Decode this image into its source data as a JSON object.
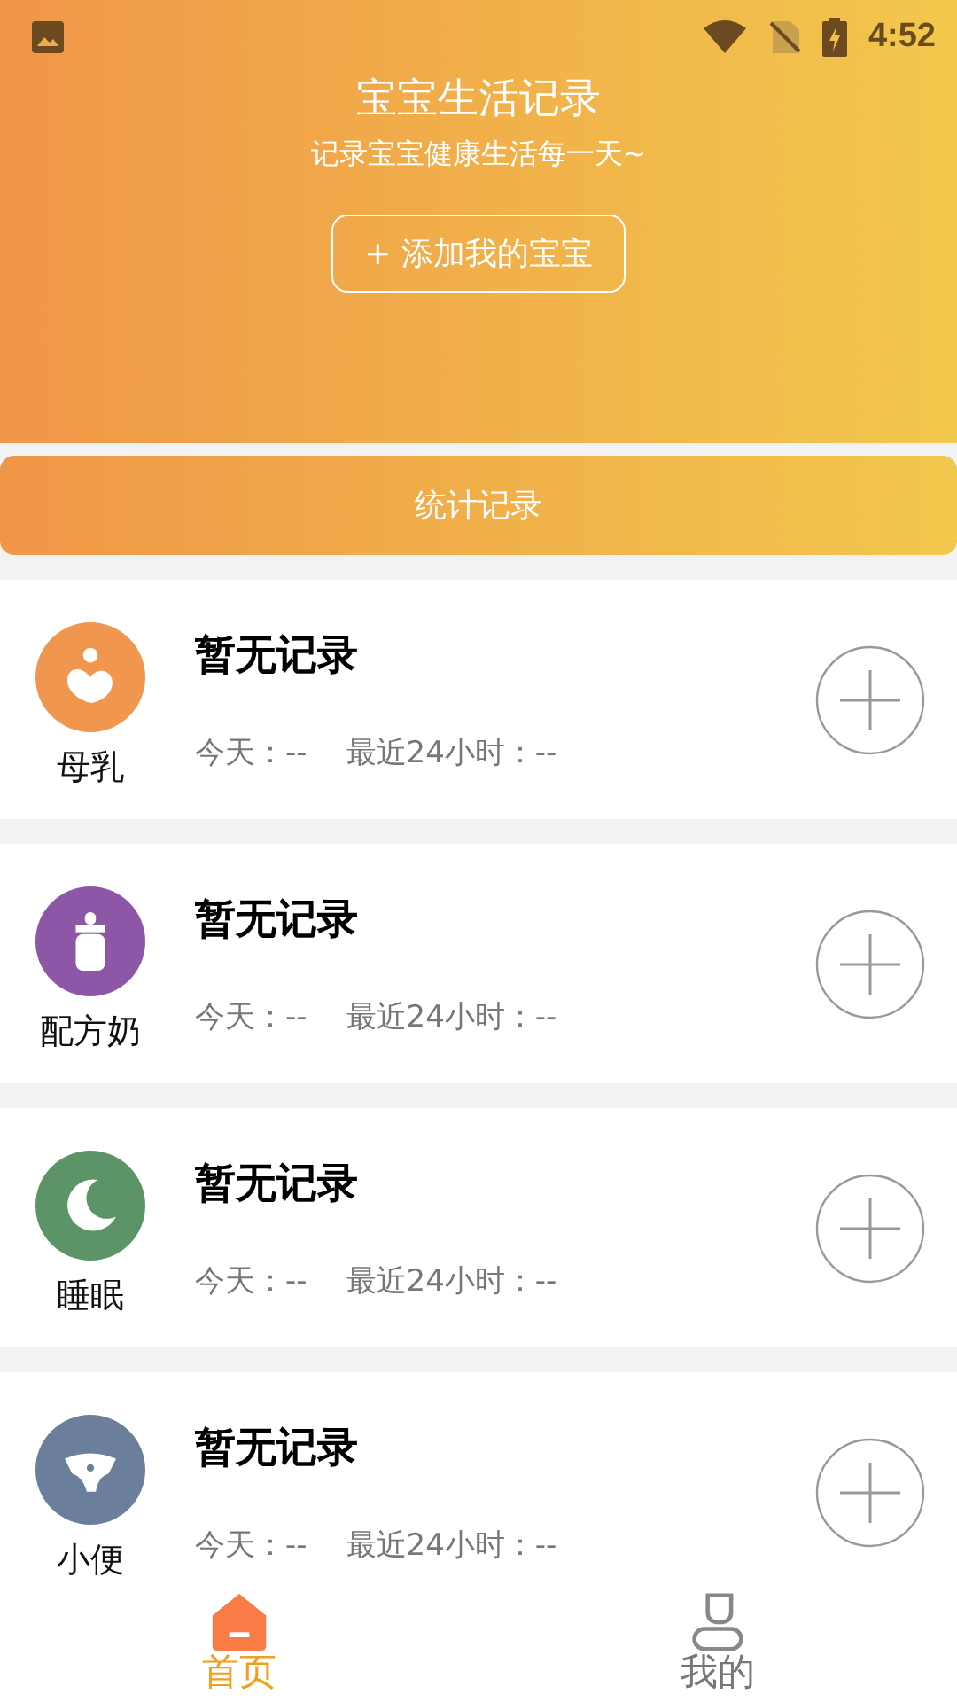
{
  "status_bar": {
    "time": "4:52"
  },
  "header": {
    "title": "宝宝生活记录",
    "subtitle": "记录宝宝健康生活每一天~",
    "add_button": "+ 添加我的宝宝"
  },
  "stats_button": "统计记录",
  "records": [
    {
      "kind": "breast",
      "name": "母乳",
      "color": "#f0964e",
      "status": "暂无记录",
      "today": "今天：--",
      "last24": "最近24小时：--"
    },
    {
      "kind": "formula",
      "name": "配方奶",
      "color": "#8e56a6",
      "status": "暂无记录",
      "today": "今天：--",
      "last24": "最近24小时：--"
    },
    {
      "kind": "sleep",
      "name": "睡眠",
      "color": "#5c9467",
      "status": "暂无记录",
      "today": "今天：--",
      "last24": "最近24小时：--"
    },
    {
      "kind": "diaper",
      "name": "小便",
      "color": "#6b7f9c",
      "status": "暂无记录",
      "today": "今天：--",
      "last24": "最近24小时：--"
    }
  ],
  "tabs": [
    {
      "kind": "home",
      "label": "首页",
      "selected": true
    },
    {
      "kind": "me",
      "label": "我的",
      "selected": false
    }
  ]
}
